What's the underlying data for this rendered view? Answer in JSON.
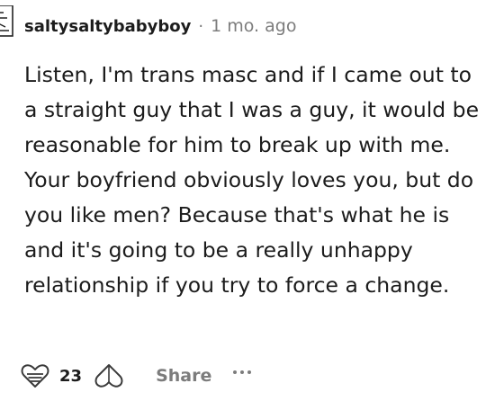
{
  "comment": {
    "username": "saltysaltybabyboy",
    "separator": "·",
    "timestamp": "1 mo. ago",
    "body": "Listen, I'm trans masc and if I came out to a straight guy that I was a guy, it would be reasonable for him to break up with me. Your boyfriend obviously loves you, but do you like men? Because that's what he is and it's going to be a really unhappy relationship if you try to force a change."
  },
  "actions": {
    "vote_count": "23",
    "share_label": "Share",
    "upvote_icon": "heart-upvote-icon",
    "downvote_icon": "heart-downvote-icon",
    "more_icon": "more-options-icon"
  },
  "colors": {
    "text": "#1c1c1c",
    "meta": "#7c7c7c"
  }
}
